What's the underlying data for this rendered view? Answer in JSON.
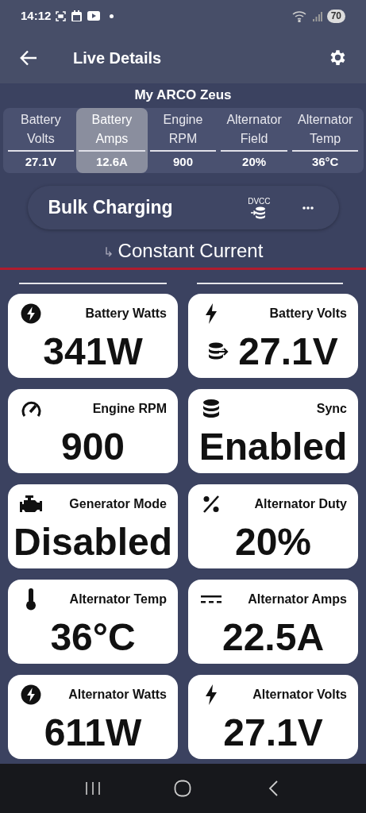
{
  "status_bar": {
    "time": "14:12",
    "battery": "70"
  },
  "app_bar": {
    "title": "Live Details"
  },
  "device": {
    "name": "My ARCO Zeus"
  },
  "tabs": [
    {
      "label": "Battery Volts",
      "value": "27.1V",
      "selected": false
    },
    {
      "label": "Battery Amps",
      "value": "12.6A",
      "selected": true
    },
    {
      "label": "Engine RPM",
      "value": "900",
      "selected": false
    },
    {
      "label": "Alternator Field",
      "value": "20%",
      "selected": false
    },
    {
      "label": "Alternator Temp",
      "value": "36°C",
      "selected": false
    }
  ],
  "charge_state": {
    "title": "Bulk Charging",
    "badge": "DVCC",
    "sub_arrow": "↳",
    "substate": "Constant Current"
  },
  "cards": [
    {
      "title": "Battery Watts",
      "value": "341W"
    },
    {
      "title": "Battery Volts",
      "value": "27.1V"
    },
    {
      "title": "Engine RPM",
      "value": "900"
    },
    {
      "title": "Sync",
      "value": "Enabled"
    },
    {
      "title": "Generator Mode",
      "value": "Disabled"
    },
    {
      "title": "Alternator Duty",
      "value": "20%"
    },
    {
      "title": "Alternator Temp",
      "value": "36°C"
    },
    {
      "title": "Alternator Amps",
      "value": "22.5A"
    },
    {
      "title": "Alternator Watts",
      "value": "611W"
    },
    {
      "title": "Alternator Volts",
      "value": "27.1V"
    }
  ]
}
